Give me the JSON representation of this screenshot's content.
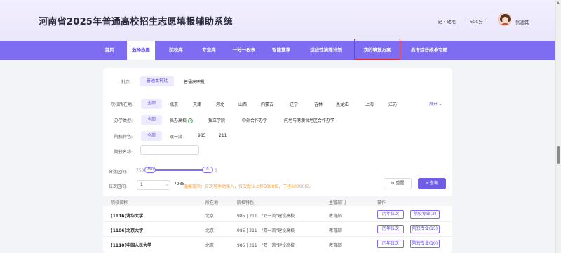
{
  "header": {
    "title": "河南省2025年普通高校招生志愿填报辅助系统",
    "subjects": "史 · 政地",
    "separator": "|",
    "score": "600分",
    "caret": "⌄",
    "username": "张滤其"
  },
  "nav": {
    "items": [
      {
        "label": "首页"
      },
      {
        "label": "选择志愿"
      },
      {
        "label": "院校库"
      },
      {
        "label": "专业库"
      },
      {
        "label": "一分一段表"
      },
      {
        "label": "智能推荐"
      },
      {
        "label": "适应性演练计划"
      },
      {
        "label": "我的填报方案"
      },
      {
        "label": "高考综合改革专题"
      }
    ]
  },
  "filters": {
    "batch": {
      "label": "批次:",
      "options": [
        "普通本科批",
        "普通高职批"
      ]
    },
    "location": {
      "label": "院校所在地:",
      "options": [
        "全部",
        "北京",
        "天津",
        "河北",
        "山西",
        "内蒙古",
        "辽宁",
        "吉林",
        "黑龙江",
        "上海",
        "江苏"
      ],
      "expand": "展开"
    },
    "type": {
      "label": "办学类型:",
      "options": [
        "全部",
        "民办高校",
        "独立学院",
        "中外合作办学",
        "内地与港澳台地区合作办学"
      ],
      "help": "?"
    },
    "feature": {
      "label": "院校特色:",
      "options": [
        "全部",
        "双一流",
        "985",
        "211"
      ]
    },
    "name": {
      "label": "院校名称:",
      "placeholder": ""
    },
    "score_range": {
      "label": "分数区间:",
      "min_text": "750",
      "low_tag": "750",
      "high_tag": "0",
      "max_text": "0"
    },
    "rank_range": {
      "label": "位次区间:",
      "from": "1",
      "to": "7985",
      "hint": "温馨提示：位次可手动输入，位次默认上移5000位，下移80000位。"
    },
    "reset": "重置",
    "query": "查询",
    "reset_icon": "↻",
    "query_icon": "⌕"
  },
  "table": {
    "headers": [
      "院校名称",
      "所在地",
      "院校特色",
      "主管部门",
      "操作"
    ],
    "rows": [
      {
        "name": "(1116)清华大学",
        "location": "北京",
        "feature": "985 | 211 | \"双一流\"建设高校",
        "dept": "教育部",
        "btn1": "历年位次",
        "btn2": "院校专业(2)"
      },
      {
        "name": "(1106)北京大学",
        "location": "北京",
        "feature": "985 | 211 | \"双一流\"建设高校",
        "dept": "教育部",
        "btn1": "历年位次",
        "btn2": "院校专业(15)"
      },
      {
        "name": "(1110)中国人民大学",
        "location": "北京",
        "feature": "985 | 211 | \"双一流\"建设高校",
        "dept": "教育部",
        "btn1": "历年位次",
        "btn2": "院校专业(10)"
      }
    ]
  },
  "colors": {
    "accent": "#7e6df0",
    "highlight": "#e22a2a",
    "hint": "#f0a040"
  }
}
